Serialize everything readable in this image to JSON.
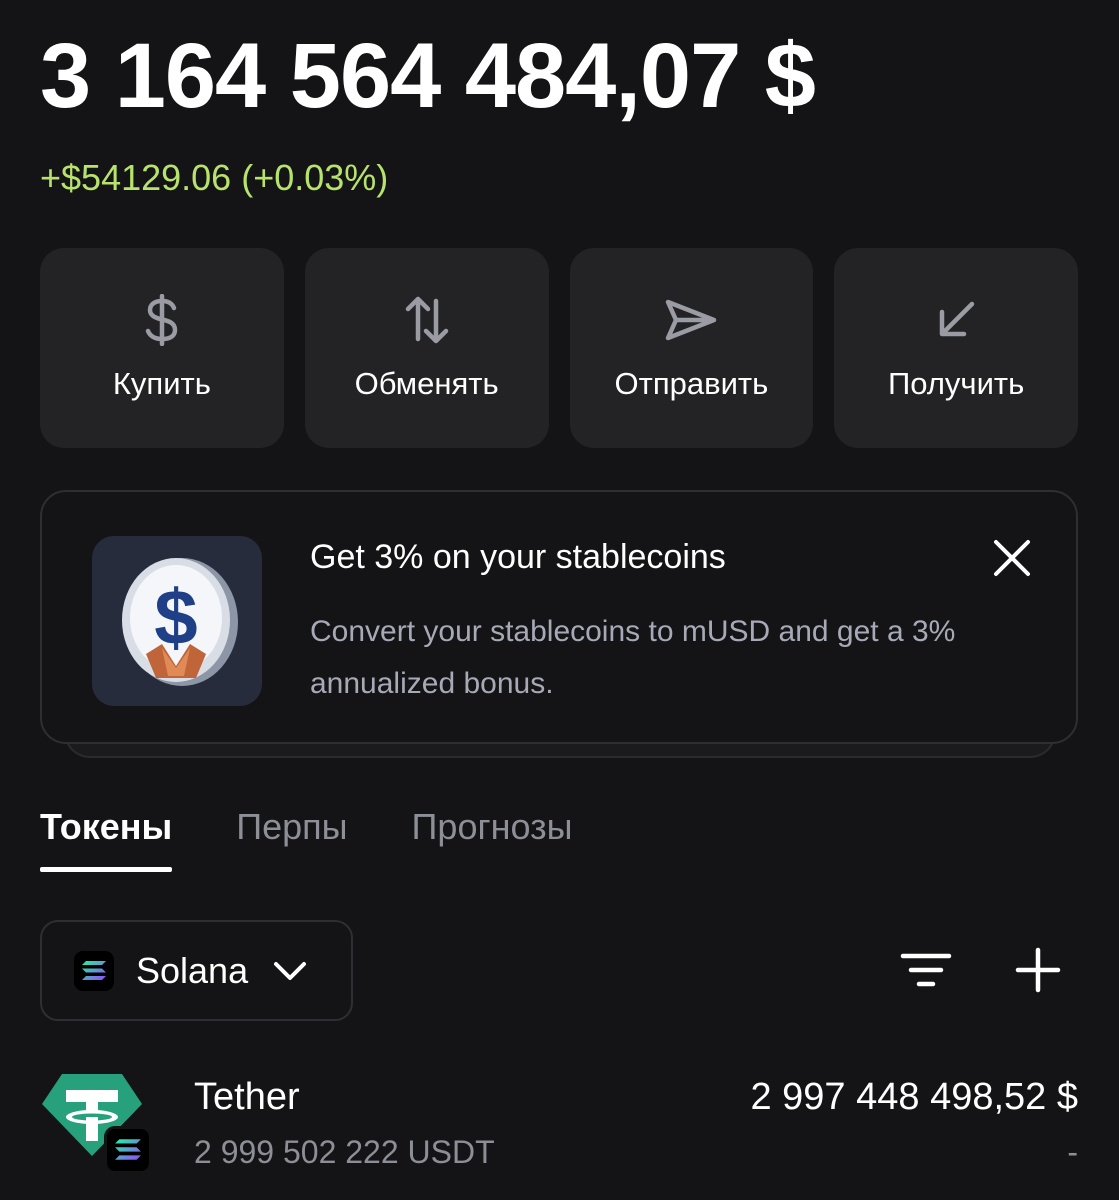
{
  "balance": {
    "total": "3 164 564 484,07 $",
    "change": "+$54129.06 (+0.03%)",
    "change_color": "#b7e26b"
  },
  "actions": [
    {
      "label": "Купить",
      "icon": "dollar-icon"
    },
    {
      "label": "Обменять",
      "icon": "swap-arrows-icon"
    },
    {
      "label": "Отправить",
      "icon": "send-icon"
    },
    {
      "label": "Получить",
      "icon": "receive-arrow-icon"
    }
  ],
  "promo": {
    "title": "Get 3% on your stablecoins",
    "text": "Convert your stablecoins to mUSD and get a 3% annualized bonus.",
    "image_icon": "dollar-coin-icon",
    "close_icon": "close-icon"
  },
  "tabs": [
    {
      "label": "Токены",
      "active": true
    },
    {
      "label": "Перпы",
      "active": false
    },
    {
      "label": "Прогнозы",
      "active": false
    }
  ],
  "network": {
    "label": "Solana",
    "icon": "solana-icon"
  },
  "toolbar": {
    "filter_icon": "filter-icon",
    "add_icon": "plus-icon"
  },
  "tokens": [
    {
      "name": "Tether",
      "amount": "2 999 502 222 USDT",
      "value": "2 997 448 498,52 $",
      "change": "-",
      "icon": "tether-icon",
      "network_icon": "solana-icon",
      "brand_color": "#26a17b"
    }
  ]
}
